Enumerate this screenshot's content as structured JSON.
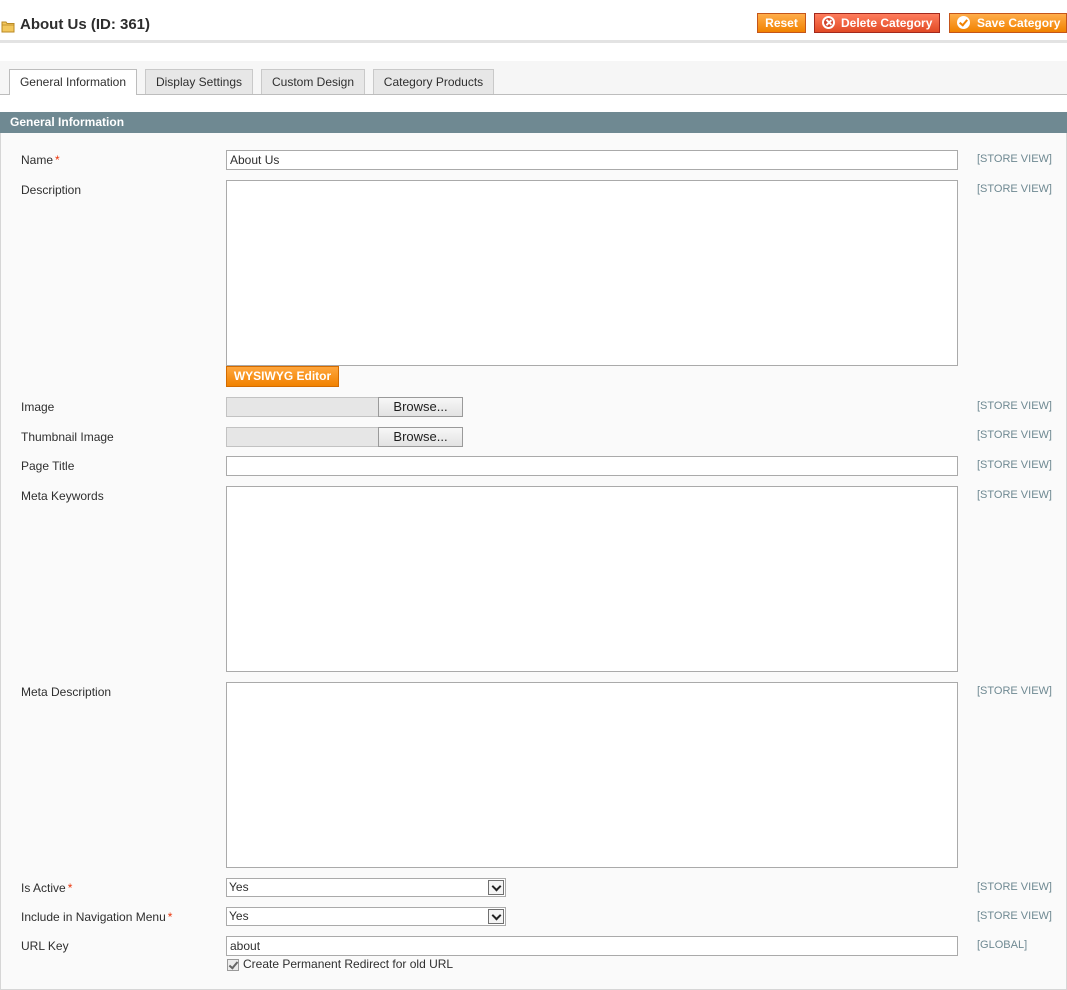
{
  "header": {
    "title": "About Us (ID: 361)",
    "buttons": {
      "reset": "Reset",
      "delete": "Delete Category",
      "save": "Save Category"
    }
  },
  "tabs": [
    {
      "label": "General Information",
      "active": true
    },
    {
      "label": "Display Settings",
      "active": false
    },
    {
      "label": "Custom Design",
      "active": false
    },
    {
      "label": "Category Products",
      "active": false
    }
  ],
  "section": {
    "title": "General Information"
  },
  "fields": {
    "name": {
      "label": "Name",
      "required": "*",
      "value": "About Us",
      "scope": "[STORE VIEW]"
    },
    "description": {
      "label": "Description",
      "scope": "[STORE VIEW]",
      "editor_button": "WYSIWYG Editor"
    },
    "image": {
      "label": "Image",
      "browse": "Browse...",
      "scope": "[STORE VIEW]"
    },
    "thumbnail": {
      "label": "Thumbnail Image",
      "browse": "Browse...",
      "scope": "[STORE VIEW]"
    },
    "page_title": {
      "label": "Page Title",
      "value": "",
      "scope": "[STORE VIEW]"
    },
    "meta_keywords": {
      "label": "Meta Keywords",
      "scope": "[STORE VIEW]"
    },
    "meta_description": {
      "label": "Meta Description",
      "scope": "[STORE VIEW]"
    },
    "is_active": {
      "label": "Is Active",
      "required": "*",
      "value": "Yes",
      "scope": "[STORE VIEW]"
    },
    "include_in_menu": {
      "label": "Include in Navigation Menu",
      "required": "*",
      "value": "Yes",
      "scope": "[STORE VIEW]"
    },
    "url_key": {
      "label": "URL Key",
      "value": "about",
      "scope": "[GLOBAL]",
      "redirect_label": "Create Permanent Redirect for old URL",
      "redirect_checked": true
    }
  },
  "colors": {
    "accent_orange": "#f18200",
    "delete_red": "#e14a25",
    "section_header": "#6f8992"
  },
  "icons": {
    "title": "folder-icon",
    "delete": "delete-icon",
    "save": "check-icon"
  }
}
